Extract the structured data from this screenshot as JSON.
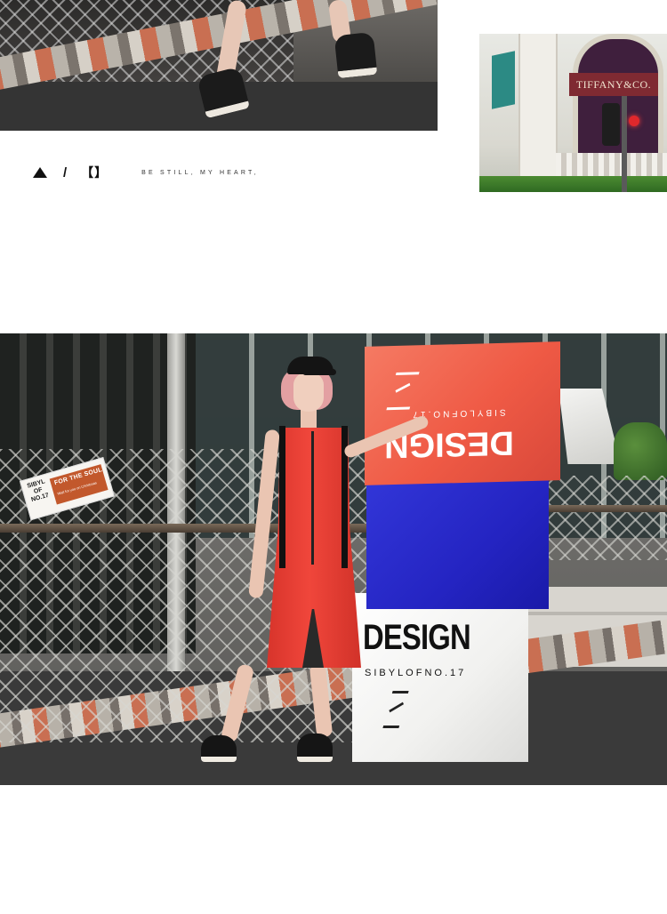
{
  "caption": {
    "slash": "/",
    "bracket": "【】",
    "tagline": "BE STILL, MY HEART,"
  },
  "side_photo": {
    "store_sign": "TIFFANY&CO."
  },
  "main_photo": {
    "sticker": {
      "brand": "SIBYL OF NO.17",
      "title": "FOR THE SOUL",
      "subtitle": "Wait for you on Christmas"
    },
    "red_box": {
      "word": "DESIGN",
      "sub": "SIBYLOFNO.17"
    },
    "white_box": {
      "word": "DESIGN",
      "sub": "SIBYLOFNO.17"
    }
  },
  "colors": {
    "dress": "#f0463b",
    "box_red": "#ef5a45",
    "box_blue": "#2424c2",
    "box_white": "#f1f1ef"
  },
  "icons": {
    "caption_marker": "triangle-up",
    "box_logo": "s-logo"
  }
}
